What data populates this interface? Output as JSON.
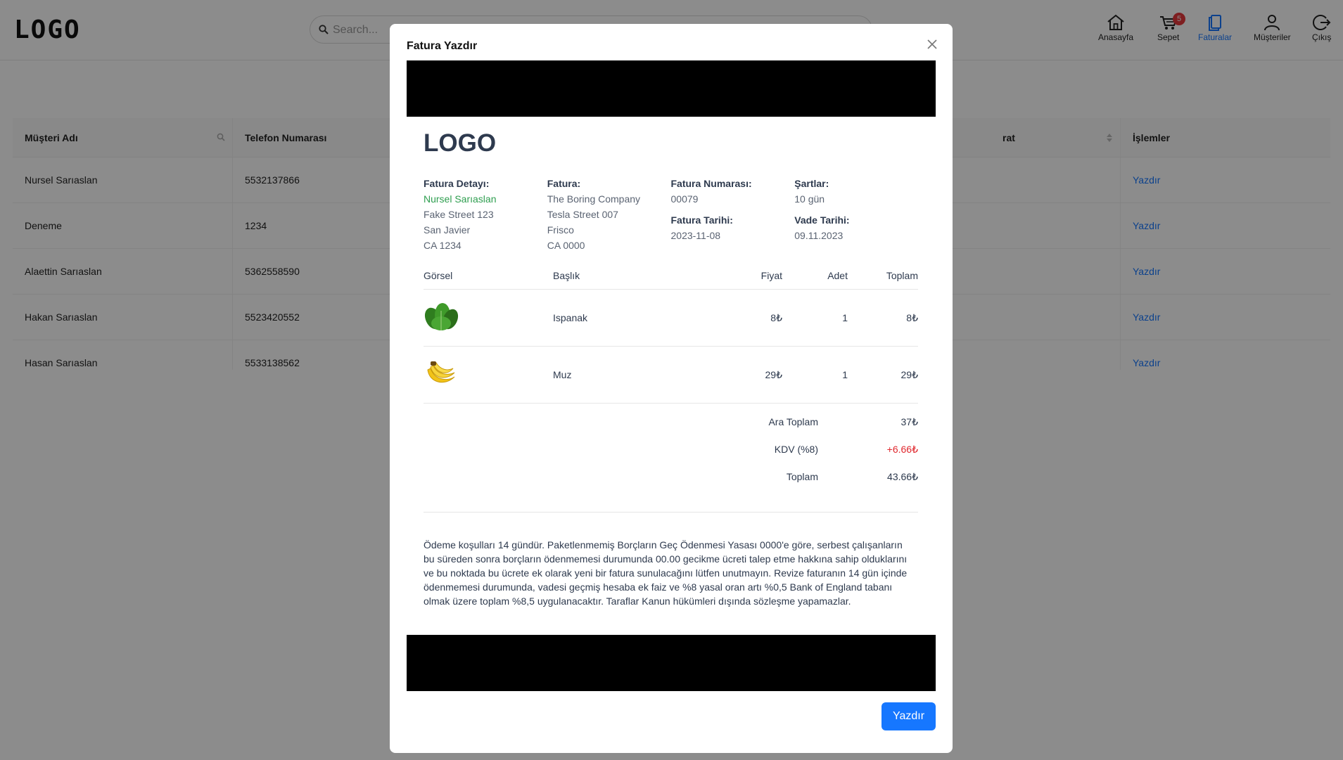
{
  "header": {
    "logo": "LOGO",
    "search_placeholder": "Search...",
    "nav": [
      {
        "label": "Anasayfa",
        "icon": "home-icon"
      },
      {
        "label": "Sepet",
        "icon": "cart-icon",
        "badge": "5"
      },
      {
        "label": "Faturalar",
        "icon": "invoice-icon",
        "active": true
      },
      {
        "label": "Müşteriler",
        "icon": "user-icon"
      },
      {
        "label": "Çıkış",
        "icon": "logout-icon"
      }
    ]
  },
  "table": {
    "columns": [
      "Müşteri Adı",
      "Telefon Numarası",
      "rat",
      "İşlemler"
    ],
    "rows": [
      {
        "name": "Nursel Sarıaslan",
        "phone": "5532137866",
        "action": "Yazdır"
      },
      {
        "name": "Deneme",
        "phone": "1234",
        "action": "Yazdır"
      },
      {
        "name": "Alaettin Sarıaslan",
        "phone": "5362558590",
        "action": "Yazdır"
      },
      {
        "name": "Hakan Sarıaslan",
        "phone": "5523420552",
        "action": "Yazdır"
      },
      {
        "name": "Hasan Sarıaslan",
        "phone": "5533138562",
        "action": "Yazdır"
      }
    ]
  },
  "modal": {
    "title": "Fatura Yazdır",
    "logo": "LOGO",
    "detail": {
      "label": "Fatura Detayı:",
      "name": "Nursel Sarıaslan",
      "line1": "Fake Street 123",
      "line2": "San Javier",
      "line3": "CA 1234"
    },
    "invoice": {
      "label": "Fatura:",
      "company": "The Boring Company",
      "line1": "Tesla Street 007",
      "line2": "Frisco",
      "line3": "CA 0000"
    },
    "number": {
      "label": "Fatura Numarası:",
      "value": "00079",
      "date_label": "Fatura Tarihi:",
      "date": "2023-11-08"
    },
    "terms_info": {
      "label": "Şartlar:",
      "value": "10 gün",
      "due_label": "Vade Tarihi:",
      "due": "09.11.2023"
    },
    "items_header": {
      "image": "Görsel",
      "title": "Başlık",
      "price": "Fiyat",
      "qty": "Adet",
      "total": "Toplam"
    },
    "items": [
      {
        "image_icon": "spinach-icon",
        "title": "Ispanak",
        "price": "8₺",
        "qty": "1",
        "total": "8₺"
      },
      {
        "image_icon": "banana-icon",
        "title": "Muz",
        "price": "29₺",
        "qty": "1",
        "total": "29₺"
      }
    ],
    "summary": {
      "subtotal_label": "Ara Toplam",
      "subtotal": "37₺",
      "tax_label": "KDV (%8)",
      "tax": "+6.66₺",
      "total_label": "Toplam",
      "total": "43.66₺"
    },
    "terms_text": "Ödeme koşulları 14 gündür. Paketlenmemiş Borçların Geç Ödenmesi Yasası 0000'e göre, serbest çalışanların bu süreden sonra borçların ödenmemesi durumunda 00.00 gecikme ücreti talep etme hakkına sahip olduklarını ve bu noktada bu ücrete ek olarak yeni bir fatura sunulacağını lütfen unutmayın. Revize faturanın 14 gün içinde ödenmemesi durumunda, vadesi geçmiş hesaba ek faiz ve %8 yasal oran artı %0,5 Bank of England tabanı olmak üzere toplam %8,5 uygulanacaktır. Taraflar Kanun hükümleri dışında sözleşme yapamazlar.",
    "print_button": "Yazdır"
  }
}
